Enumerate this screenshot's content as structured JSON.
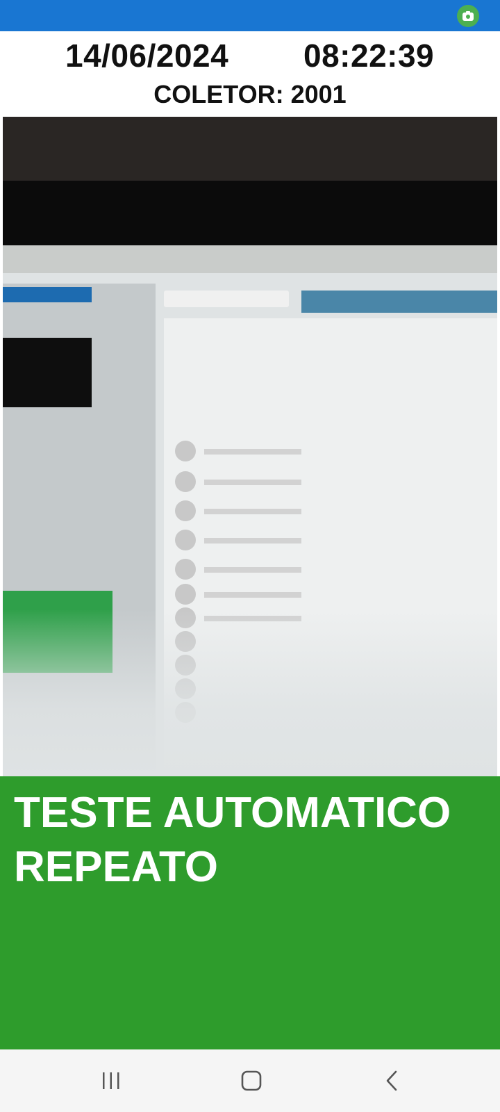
{
  "status_bar": {
    "icons": [
      "camera-icon"
    ],
    "background": "#1976d2"
  },
  "header": {
    "date": "14/06/2024",
    "time": "08:22:39",
    "collector_label": "COLETOR: 2001"
  },
  "camera_view": {
    "content": "camera-photo"
  },
  "result_panel": {
    "line1": "TESTE AUTOMATICO",
    "line2": "REPEATO",
    "background": "#2e9c2c"
  },
  "navigation_bar": {
    "buttons": [
      "recent-apps-icon",
      "home-icon",
      "back-icon"
    ]
  }
}
